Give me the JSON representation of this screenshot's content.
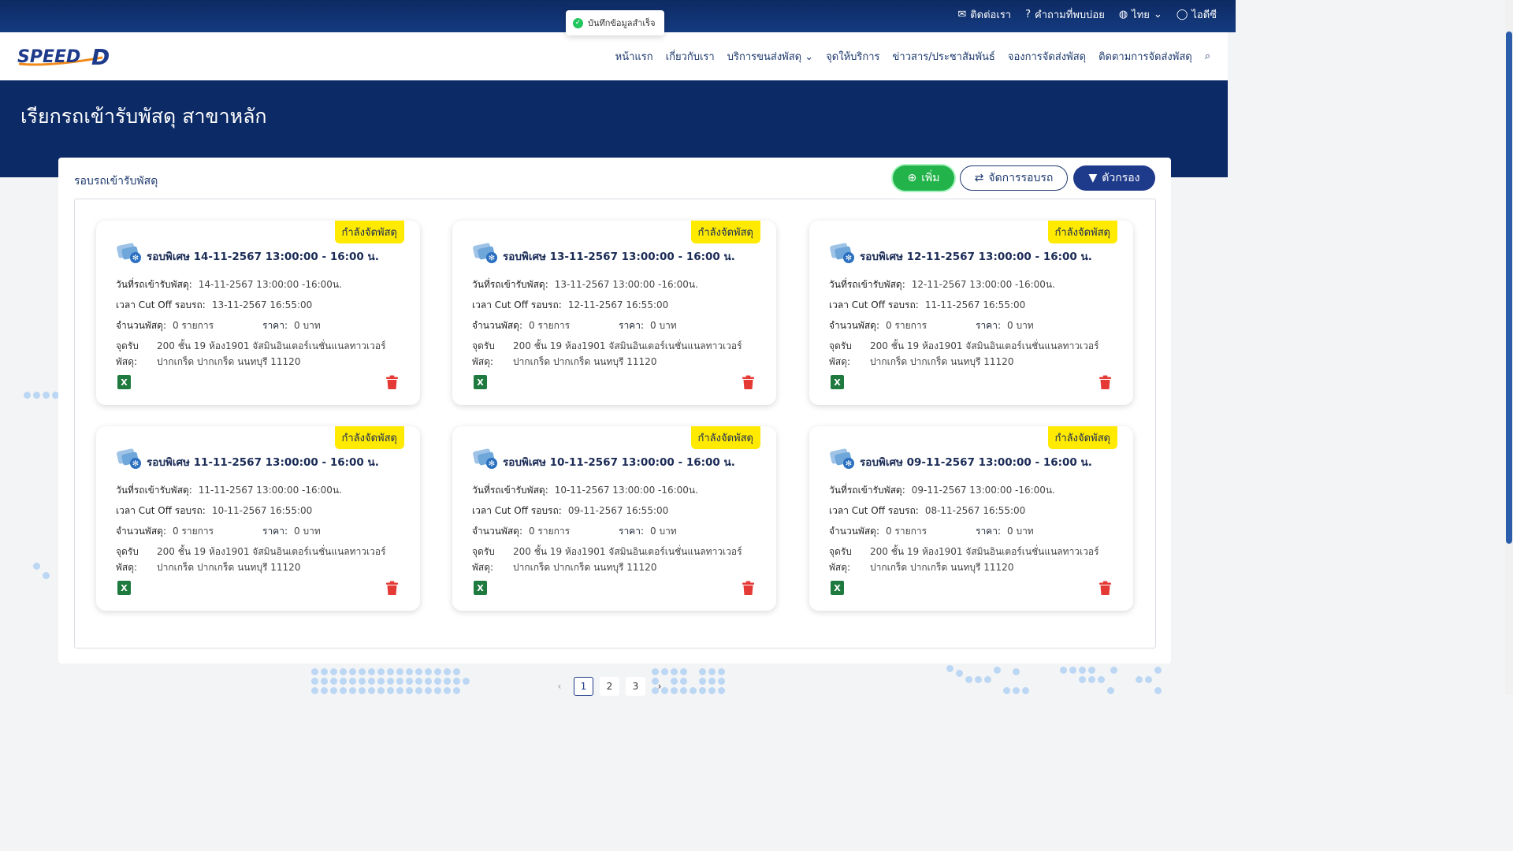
{
  "topbar": {
    "contact": "ติดต่อเรา",
    "faq": "คำถามที่พบบ่อย",
    "language": "ไทย",
    "user": "ไอดีซี"
  },
  "toast": {
    "message": "บันทึกข้อมูลสำเร็จ"
  },
  "logo": {
    "text": "SPEED",
    "letter": "D"
  },
  "nav": {
    "items": [
      "หน้าแรก",
      "เกี่ยวกับเรา",
      "บริการขนส่งพัสดุ",
      "จุดให้บริการ",
      "ข่าวสาร/ประชาสัมพันธ์",
      "จองการจัดส่งพัสดุ",
      "ติดตามการจัดส่งพัสดุ"
    ]
  },
  "hero": {
    "title": "เรียกรถเข้ารับพัสดุ สาขาหลัก"
  },
  "panel": {
    "title": "รอบรถเข้ารับพัสดุ",
    "add_label": "เพิ่ม",
    "manage_label": "จัดการรอบรถ",
    "filter_label": "ตัวกรอง"
  },
  "labels": {
    "status": "กำลังจัดพัสดุ",
    "pickup_date": "วันที่รถเข้ารับพัสดุ:",
    "cutoff": "เวลา Cut Off รอบรถ:",
    "count": "จำนวนพัสดุ:",
    "price": "ราคา:",
    "address_k1": "จุดรับ",
    "address_k2": "พัสดุ:"
  },
  "cards": [
    {
      "title": "รอบพิเศษ 14-11-2567 13:00:00 - 16:00 น.",
      "pickup": "14-11-2567 13:00:00 -16:00น.",
      "cutoff": "13-11-2567 16:55:00",
      "count": "0 รายการ",
      "price": "0 บาท",
      "addr1": "200 ชั้น 19 ห้อง1901 จัสมินอินเตอร์เนชั่นแนลทาวเวอร์",
      "addr2": "ปากเกร็ด ปากเกร็ด นนทบุรี 11120"
    },
    {
      "title": "รอบพิเศษ 13-11-2567 13:00:00 - 16:00 น.",
      "pickup": "13-11-2567 13:00:00 -16:00น.",
      "cutoff": "12-11-2567 16:55:00",
      "count": "0 รายการ",
      "price": "0 บาท",
      "addr1": "200 ชั้น 19 ห้อง1901 จัสมินอินเตอร์เนชั่นแนลทาวเวอร์",
      "addr2": "ปากเกร็ด ปากเกร็ด นนทบุรี 11120"
    },
    {
      "title": "รอบพิเศษ 12-11-2567 13:00:00 - 16:00 น.",
      "pickup": "12-11-2567 13:00:00 -16:00น.",
      "cutoff": "11-11-2567 16:55:00",
      "count": "0 รายการ",
      "price": "0 บาท",
      "addr1": "200 ชั้น 19 ห้อง1901 จัสมินอินเตอร์เนชั่นแนลทาวเวอร์",
      "addr2": "ปากเกร็ด ปากเกร็ด นนทบุรี 11120"
    },
    {
      "title": "รอบพิเศษ 11-11-2567 13:00:00 - 16:00 น.",
      "pickup": "11-11-2567 13:00:00 -16:00น.",
      "cutoff": "10-11-2567 16:55:00",
      "count": "0 รายการ",
      "price": "0 บาท",
      "addr1": "200 ชั้น 19 ห้อง1901 จัสมินอินเตอร์เนชั่นแนลทาวเวอร์",
      "addr2": "ปากเกร็ด ปากเกร็ด นนทบุรี 11120"
    },
    {
      "title": "รอบพิเศษ 10-11-2567 13:00:00 - 16:00 น.",
      "pickup": "10-11-2567 13:00:00 -16:00น.",
      "cutoff": "09-11-2567 16:55:00",
      "count": "0 รายการ",
      "price": "0 บาท",
      "addr1": "200 ชั้น 19 ห้อง1901 จัสมินอินเตอร์เนชั่นแนลทาวเวอร์",
      "addr2": "ปากเกร็ด ปากเกร็ด นนทบุรี 11120"
    },
    {
      "title": "รอบพิเศษ 09-11-2567 13:00:00 - 16:00 น.",
      "pickup": "09-11-2567 13:00:00 -16:00น.",
      "cutoff": "08-11-2567 16:55:00",
      "count": "0 รายการ",
      "price": "0 บาท",
      "addr1": "200 ชั้น 19 ห้อง1901 จัสมินอินเตอร์เนชั่นแนลทาวเวอร์",
      "addr2": "ปากเกร็ด ปากเกร็ด นนทบุรี 11120"
    }
  ],
  "pagination": {
    "pages": [
      "1",
      "2",
      "3"
    ],
    "current": "1"
  },
  "colors": {
    "brand_navy": "#0b2a66",
    "add_green": "#22b34a",
    "status_yellow": "#ffea00",
    "delete_red": "#e53935",
    "excel_green": "#1f7a3f"
  }
}
